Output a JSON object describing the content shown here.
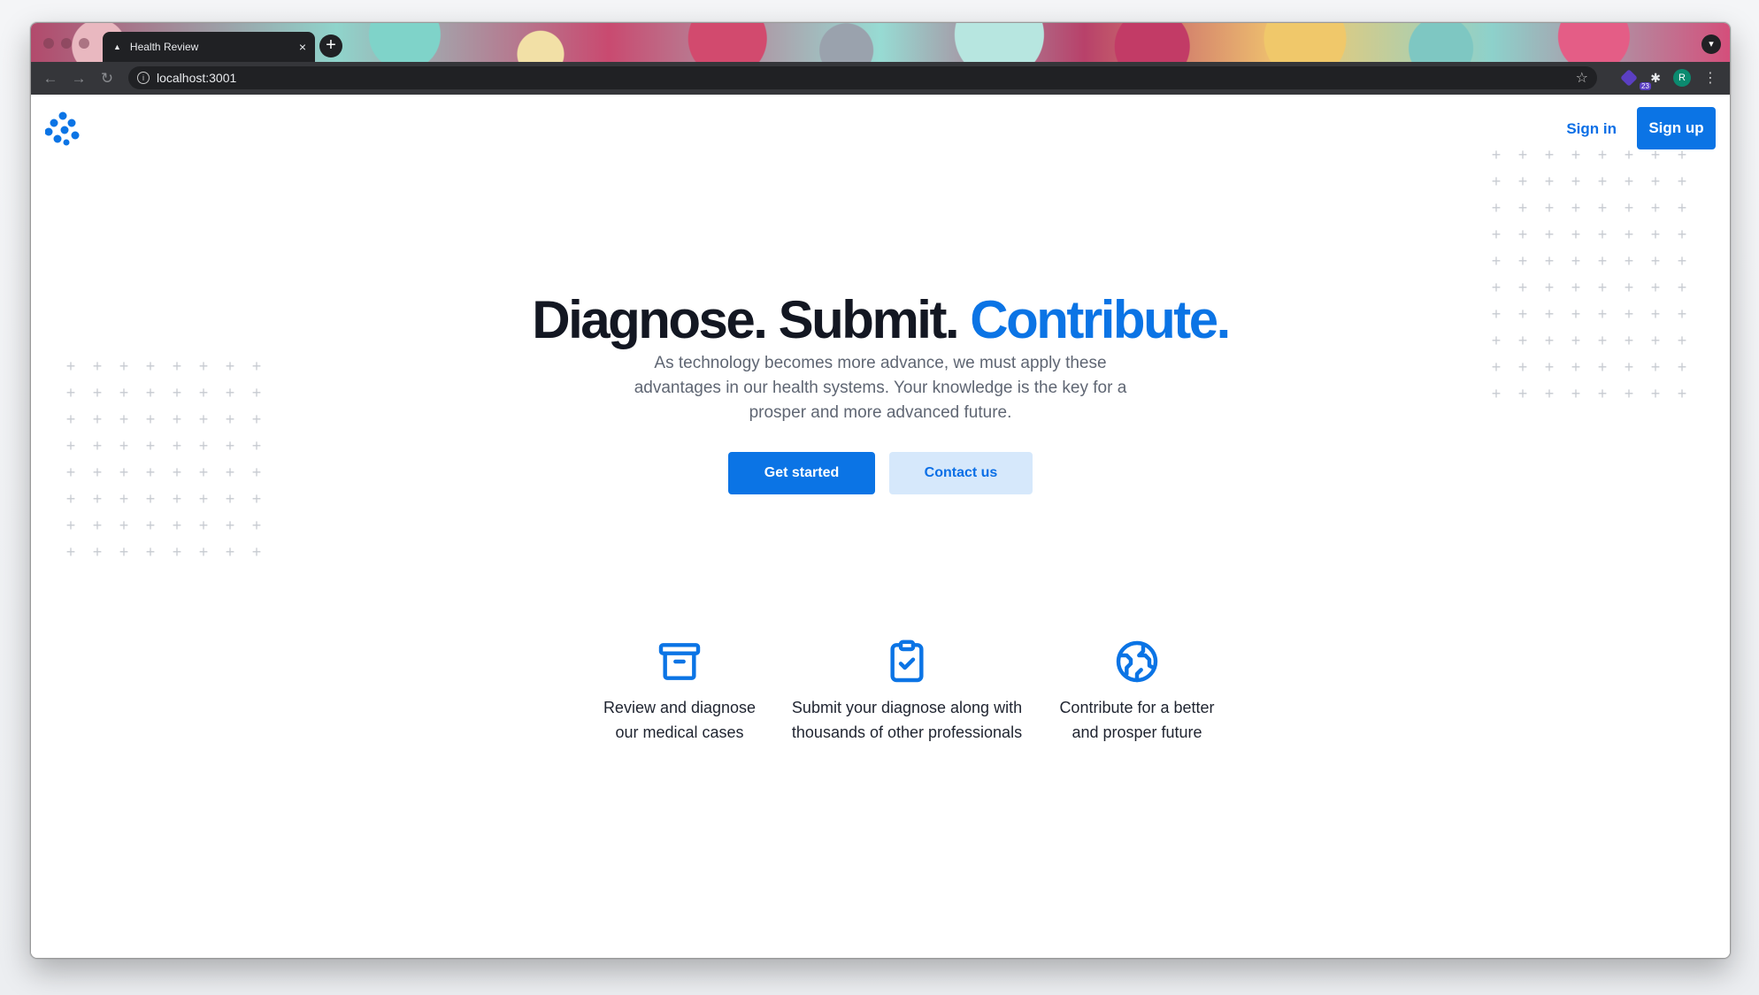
{
  "browser": {
    "tab_title": "Health Review",
    "tab_close": "×",
    "new_tab": "+",
    "url": "localhost:3001",
    "back": "←",
    "forward": "→",
    "reload": "↻",
    "star": "☆",
    "extension_count": "23",
    "puzzle": "✱",
    "profile_initial": "R",
    "menu": "⋮"
  },
  "header": {
    "logo_icon": "dots-cluster-logo",
    "sign_in": "Sign in",
    "sign_up": "Sign up"
  },
  "hero": {
    "title_part1": "Diagnose. Submit.",
    "title_part2": "Contribute.",
    "subtitle": "As technology becomes more advance, we must apply these advantages in our health systems. Your knowledge is the key for a prosper and more advanced future.",
    "primary_button": "Get started",
    "secondary_button": "Contact us"
  },
  "features": [
    {
      "icon": "archive-box-icon",
      "text_line1": "Review and diagnose",
      "text_line2": "our medical cases"
    },
    {
      "icon": "clipboard-check-icon",
      "text_line1": "Submit your diagnose along with",
      "text_line2": "thousands of other professionals"
    },
    {
      "icon": "globe-icon",
      "text_line1": "Contribute for a better",
      "text_line2": "and prosper future"
    }
  ],
  "colors": {
    "accent": "#0b74e5",
    "secondary_bg": "#d6e8fb",
    "heading": "#131722",
    "plus_pattern": "#c7cbd1"
  }
}
